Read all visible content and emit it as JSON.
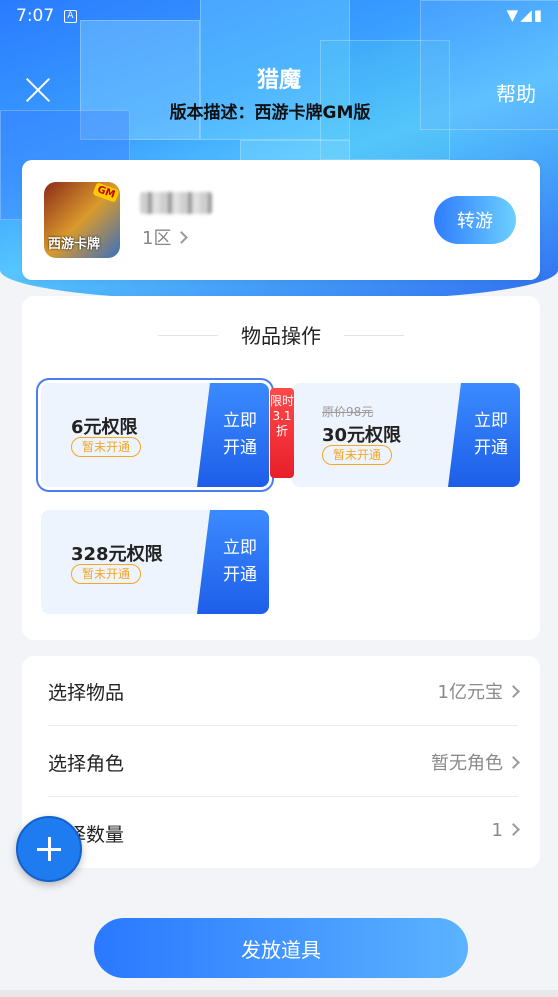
{
  "status_bar": {
    "time": "7:07",
    "notif_glyph": "A",
    "icons_text": "▼◢▮"
  },
  "nav": {
    "title": "猎魔",
    "subtitle": "版本描述：西游卡牌GM版",
    "help_label": "帮助"
  },
  "game": {
    "icon_badge": "GM",
    "icon_text": "西游卡牌",
    "server": "1区",
    "transfer_label": "转游"
  },
  "items_panel": {
    "title": "物品操作",
    "tiers": [
      {
        "label": "6元权限",
        "status": "暂未开通",
        "cta_line1": "立即",
        "cta_line2": "开通",
        "selected": true
      },
      {
        "label": "30元权限",
        "status": "暂未开通",
        "cta_line1": "立即",
        "cta_line2": "开通",
        "original_price": "原价98元",
        "limit_tag": "限时3.1折"
      },
      {
        "label": "328元权限",
        "status": "暂未开通",
        "cta_line1": "立即",
        "cta_line2": "开通"
      }
    ]
  },
  "settings": {
    "rows": [
      {
        "key": "选择物品",
        "value": "1亿元宝"
      },
      {
        "key": "选择角色",
        "value": "暂无角色"
      },
      {
        "key": "选择数量",
        "value": "1"
      }
    ]
  },
  "issue_button": "发放道具",
  "colors": {
    "primary": "#2a78ff",
    "accent_orange": "#f5a623",
    "limit_red": "#e81f2a"
  }
}
